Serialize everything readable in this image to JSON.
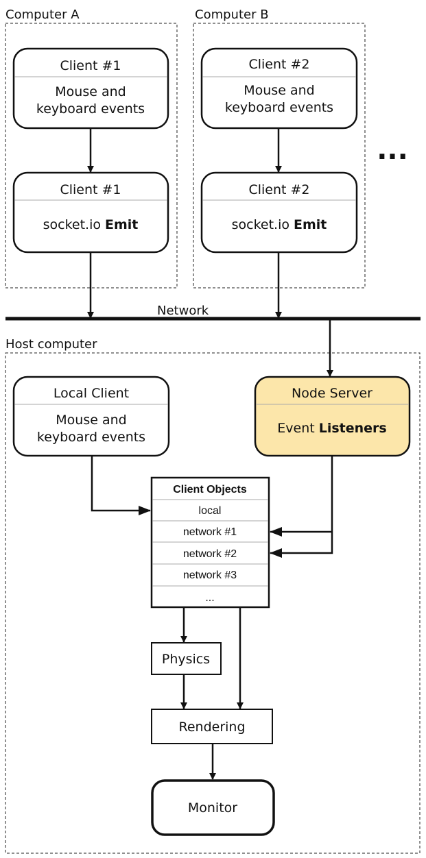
{
  "groups": {
    "computer_a": "Computer A",
    "computer_b": "Computer B",
    "host": "Host computer",
    "network": "Network",
    "ellipsis": "..."
  },
  "colors": {
    "node_server_fill": "#FCE6AA"
  },
  "client1_input": {
    "title": "Client #1",
    "line1": "Mouse and",
    "line2": "keyboard events"
  },
  "client1_emit": {
    "title": "Client #1",
    "text": "socket.io ",
    "bold": "Emit"
  },
  "client2_input": {
    "title": "Client #2",
    "line1": "Mouse and",
    "line2": "keyboard events"
  },
  "client2_emit": {
    "title": "Client #2",
    "text": "socket.io ",
    "bold": "Emit"
  },
  "local_client": {
    "title": "Local Client",
    "line1": "Mouse and",
    "line2": "keyboard events"
  },
  "node_server": {
    "title": "Node Server",
    "text": "Event ",
    "bold": "Listeners"
  },
  "client_objects": {
    "header": "Client Objects",
    "rows": [
      "local",
      "network #1",
      "network #2",
      "network #3",
      "..."
    ]
  },
  "physics": "Physics",
  "rendering": "Rendering",
  "monitor": "Monitor"
}
